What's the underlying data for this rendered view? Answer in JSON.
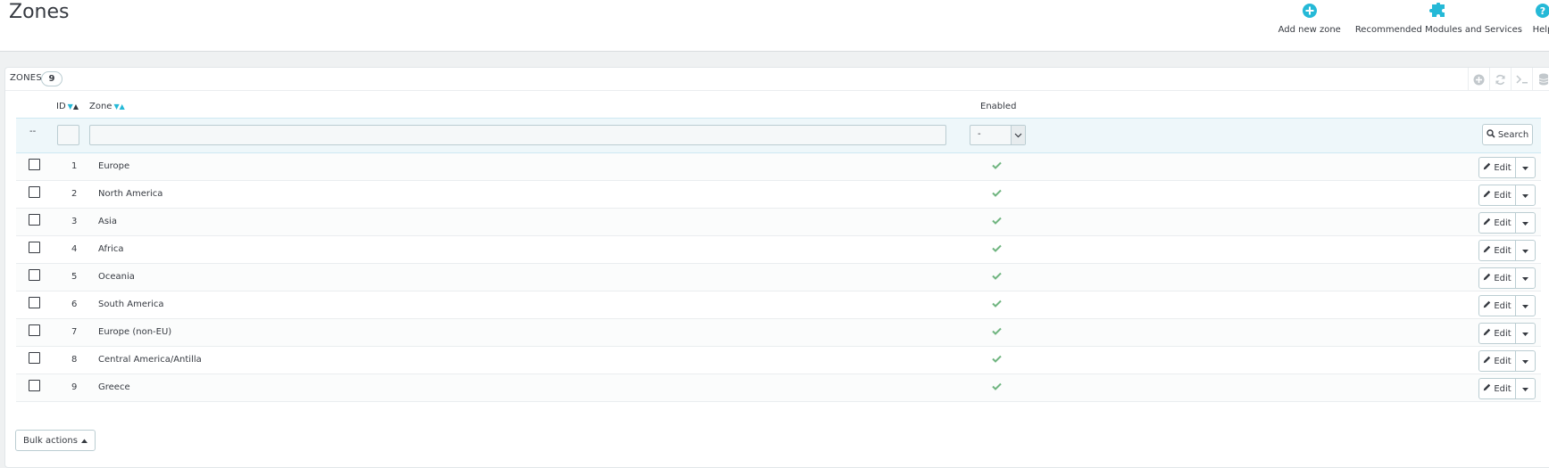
{
  "header": {
    "title": "Zones",
    "toolbar": [
      {
        "label": "Add new zone",
        "icon": "plus-circle-icon"
      },
      {
        "label": "Recommended Modules and Services",
        "icon": "puzzle-icon"
      },
      {
        "label": "Help",
        "icon": "question-circle-icon"
      }
    ]
  },
  "panel": {
    "title": "Zones",
    "count": "9",
    "tools": [
      "add-icon",
      "refresh-icon",
      "sql-icon",
      "export-icon"
    ]
  },
  "table": {
    "columns": {
      "id": "ID",
      "zone": "Zone",
      "enabled": "Enabled"
    },
    "filter": {
      "dash": "--",
      "id_value": "",
      "zone_value": "",
      "enabled_value": "-",
      "search_label": "Search"
    },
    "rows": [
      {
        "id": "1",
        "zone": "Europe",
        "enabled": true
      },
      {
        "id": "2",
        "zone": "North America",
        "enabled": true
      },
      {
        "id": "3",
        "zone": "Asia",
        "enabled": true
      },
      {
        "id": "4",
        "zone": "Africa",
        "enabled": true
      },
      {
        "id": "5",
        "zone": "Oceania",
        "enabled": true
      },
      {
        "id": "6",
        "zone": "South America",
        "enabled": true
      },
      {
        "id": "7",
        "zone": "Europe (non-EU)",
        "enabled": true
      },
      {
        "id": "8",
        "zone": "Central America/Antilla",
        "enabled": true
      },
      {
        "id": "9",
        "zone": "Greece",
        "enabled": true
      }
    ],
    "edit_label": "Edit"
  },
  "bulk_actions": "Bulk actions",
  "colors": {
    "accent": "#25b9d7",
    "success": "#70b580",
    "text": "#363a41"
  }
}
